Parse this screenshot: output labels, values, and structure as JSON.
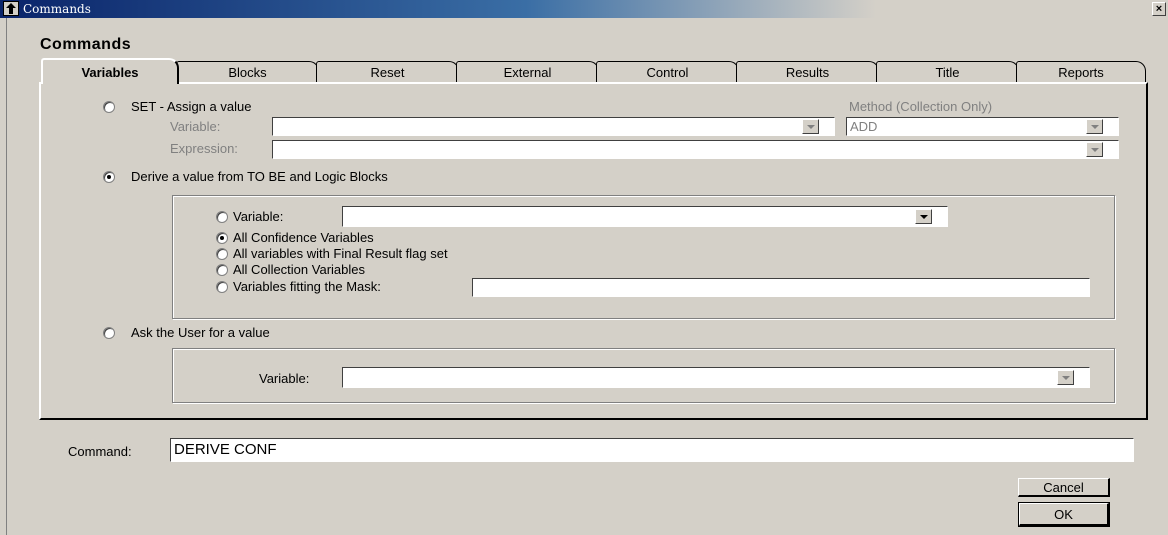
{
  "window": {
    "title": "Commands",
    "close_label": "×"
  },
  "dialog": {
    "heading": "Commands"
  },
  "tabs": [
    {
      "label": "Variables",
      "active": true
    },
    {
      "label": "Blocks"
    },
    {
      "label": "Reset"
    },
    {
      "label": "External"
    },
    {
      "label": "Control"
    },
    {
      "label": "Results"
    },
    {
      "label": "Title"
    },
    {
      "label": "Reports"
    }
  ],
  "set_section": {
    "radio_label": "SET - Assign a value",
    "variable_label": "Variable:",
    "variable_value": "",
    "expression_label": "Expression:",
    "expression_value": "",
    "method_label": "Method (Collection Only)",
    "method_value": "ADD"
  },
  "derive_section": {
    "radio_label": "Derive a value from TO BE and Logic Blocks",
    "variable_label": "Variable:",
    "variable_value": "",
    "option_all_confidence": "All Confidence Variables",
    "option_final_result": "All variables with Final Result flag set",
    "option_all_collection": "All Collection Variables",
    "option_mask": "Variables fitting the Mask:",
    "mask_value": ""
  },
  "ask_section": {
    "radio_label": "Ask the User for a value",
    "variable_label": "Variable:",
    "variable_value": ""
  },
  "command": {
    "label": "Command:",
    "value": "DERIVE CONF"
  },
  "buttons": {
    "cancel": "Cancel",
    "ok": "OK"
  }
}
